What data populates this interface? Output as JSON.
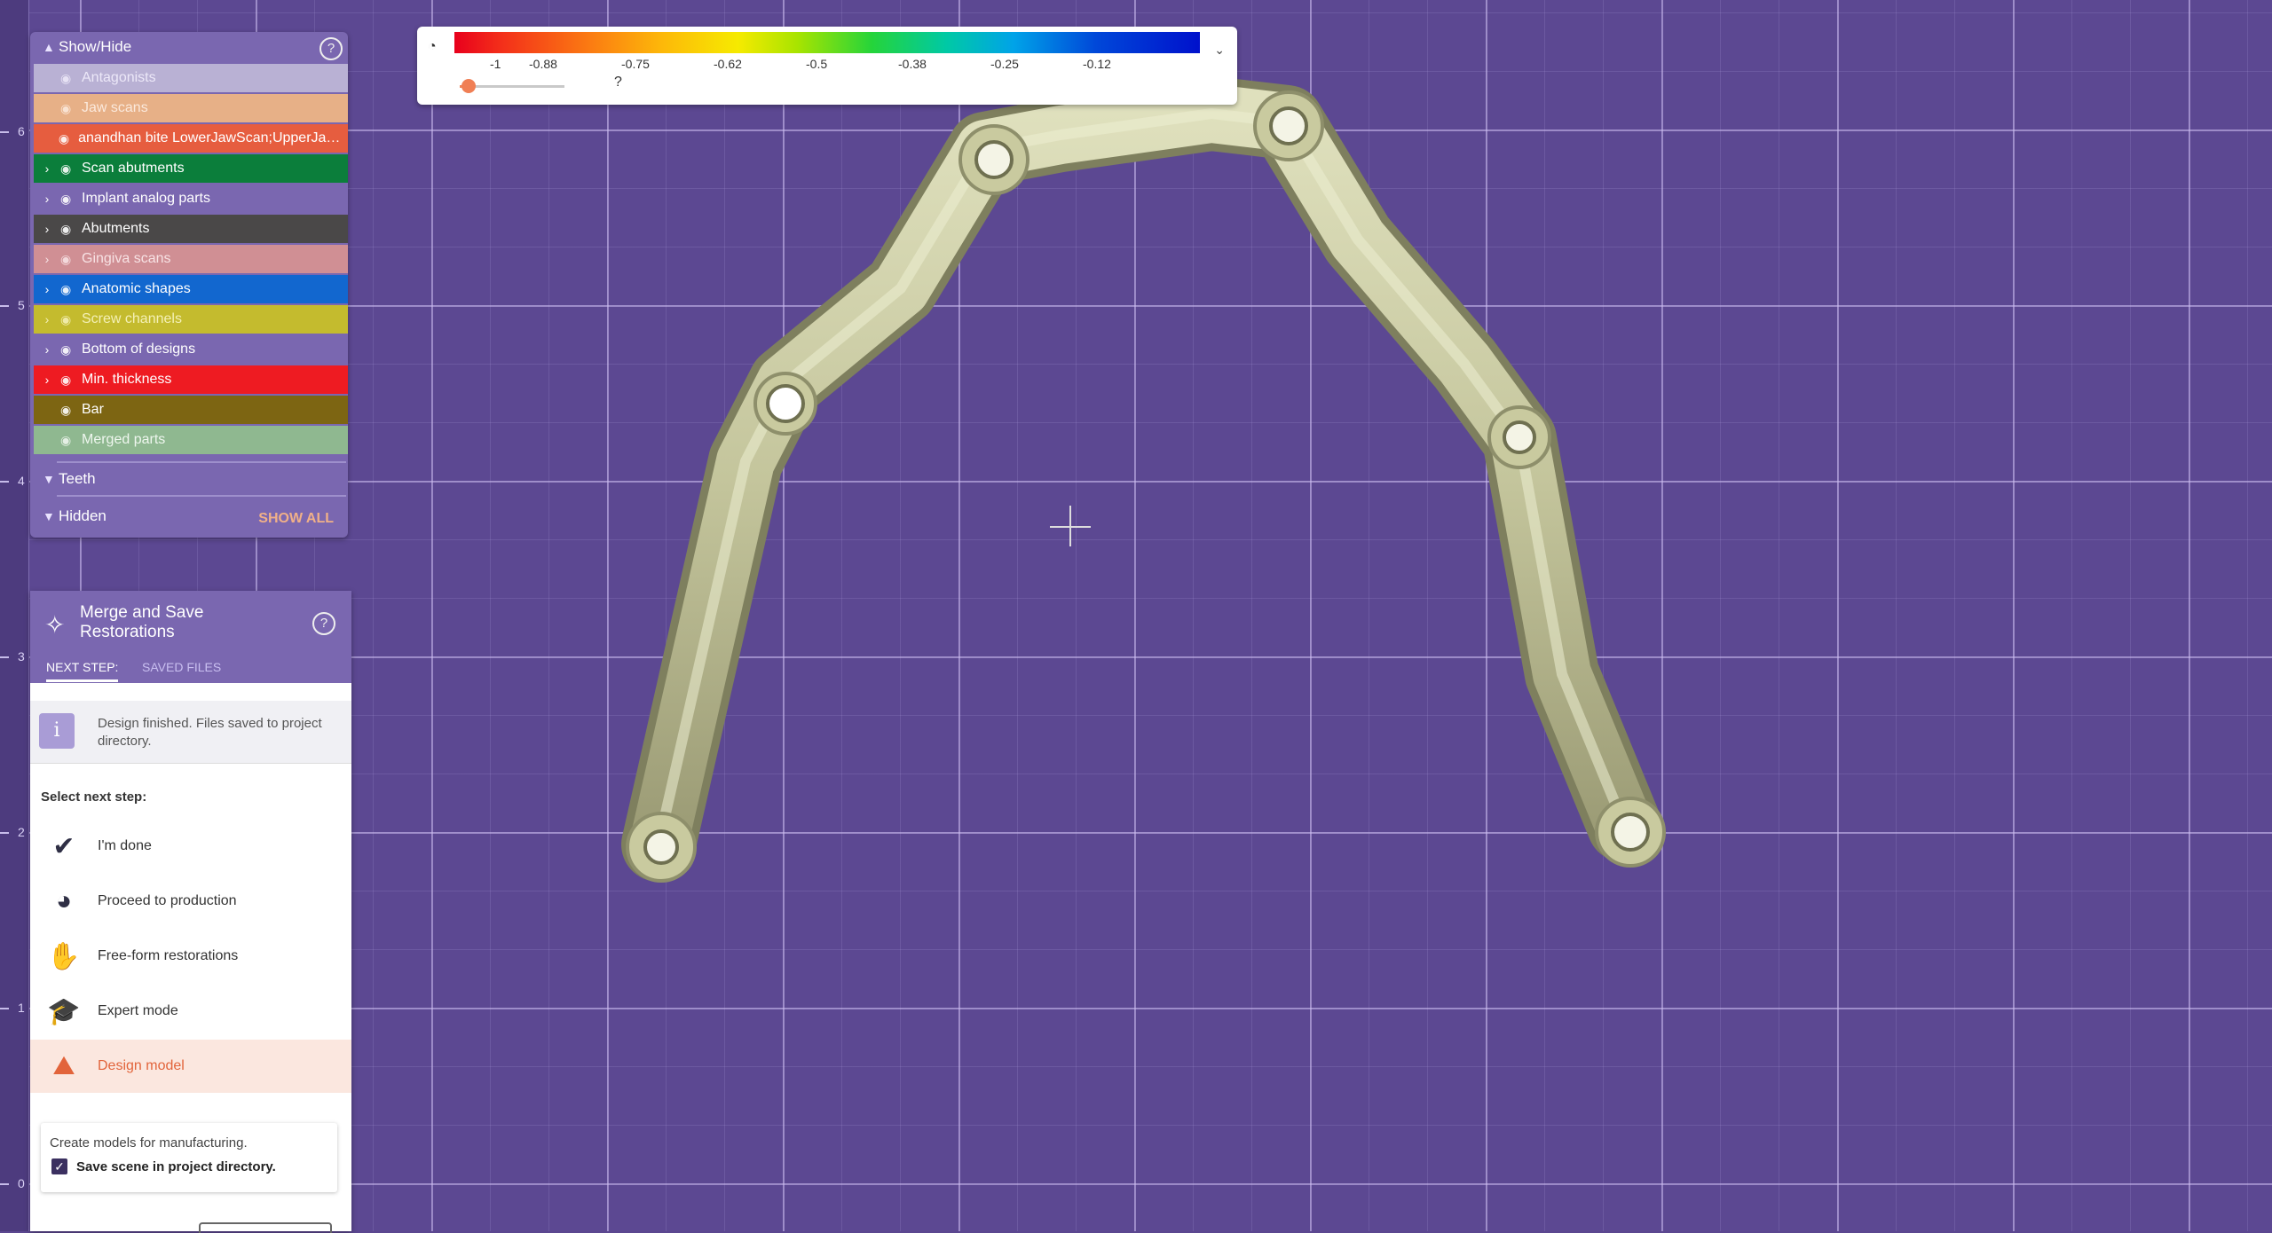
{
  "ruler": {
    "labels": [
      "6",
      "5",
      "4",
      "3",
      "2",
      "1",
      "0"
    ]
  },
  "show_hide": {
    "title": "Show/Hide",
    "layers": [
      {
        "label": "Antagonists",
        "color": "#b9b1d4",
        "text": "#ece8f8",
        "expandable": false
      },
      {
        "label": "Jaw scans",
        "color": "#e7b087",
        "text": "#fbe9dc",
        "expandable": false
      },
      {
        "label": "anandhan bite LowerJawScan;UpperJawScan",
        "color": "#e65d3f",
        "text": "#ffffff",
        "expandable": false
      },
      {
        "label": "Scan abutments",
        "color": "#0b7e3b",
        "text": "#ffffff",
        "expandable": true
      },
      {
        "label": "Implant analog parts",
        "color": "#7a67b0",
        "text": "#ffffff",
        "expandable": true
      },
      {
        "label": "Abutments",
        "color": "#4a4848",
        "text": "#ffffff",
        "expandable": true
      },
      {
        "label": "Gingiva scans",
        "color": "#d08f94",
        "text": "#f7e2e4",
        "expandable": true
      },
      {
        "label": "Anatomic shapes",
        "color": "#1267cf",
        "text": "#ffffff",
        "expandable": true
      },
      {
        "label": "Screw channels",
        "color": "#c4bb2e",
        "text": "#f4f0b6",
        "expandable": true
      },
      {
        "label": "Bottom of designs",
        "color": "#7a67b0",
        "text": "#ffffff",
        "expandable": true
      },
      {
        "label": "Min. thickness",
        "color": "#ee1b22",
        "text": "#ffffff",
        "expandable": true
      },
      {
        "label": "Bar",
        "color": "#7d6512",
        "text": "#ffffff",
        "expandable": false
      },
      {
        "label": "Merged parts",
        "color": "#8fb890",
        "text": "#eef6ee",
        "expandable": false
      }
    ],
    "teeth_label": "Teeth",
    "hidden_label": "Hidden",
    "show_all": "SHOW ALL"
  },
  "merge": {
    "title": "Merge and Save Restorations",
    "tab_next": "NEXT STEP:",
    "tab_saved": "SAVED FILES",
    "info_text": "Design finished. Files saved to project directory.",
    "select_label": "Select next step:",
    "steps": [
      {
        "label": "I'm done",
        "icon": "checkmark-icon",
        "glyph": "✔"
      },
      {
        "label": "Proceed to production",
        "icon": "production-icon",
        "glyph": "◕"
      },
      {
        "label": "Free-form restorations",
        "icon": "freeform-icon",
        "glyph": "✋"
      },
      {
        "label": "Expert mode",
        "icon": "graduation-cap-icon",
        "glyph": "🎓"
      },
      {
        "label": "Design model",
        "icon": "model-icon",
        "glyph": "⛰"
      }
    ],
    "mfg_text": "Create models for manufacturing.",
    "save_label": "Save scene in project directory.",
    "save_checked": true
  },
  "scale": {
    "labels": [
      "-1",
      "-0.88",
      "-0.75",
      "-0.62",
      "-0.5",
      "-0.38",
      "-0.25",
      "-0.12"
    ],
    "slider_value": 0.05,
    "question": "?"
  }
}
